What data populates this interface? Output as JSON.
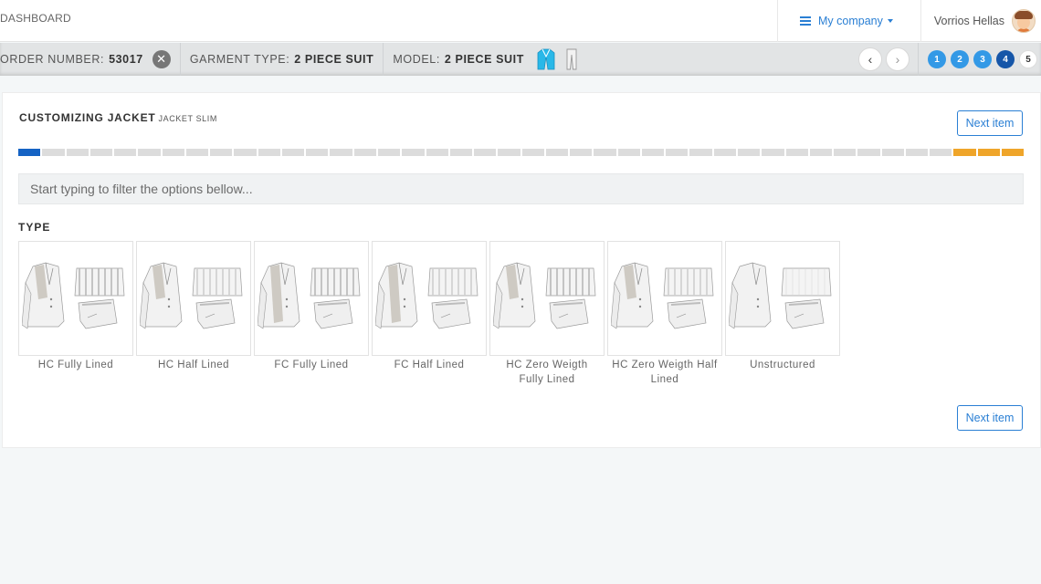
{
  "nav": {
    "brand": "DASHBOARD",
    "company": "My company",
    "user": "Vorrios Hellas"
  },
  "orderbar": {
    "order_label": "ORDER NUMBER:",
    "order_value": "53017",
    "garment_label": "GARMENT TYPE:",
    "garment_value": "2 PIECE SUIT",
    "model_label": "MODEL:",
    "model_value": "2 PIECE SUIT",
    "remove_icon": "close-circle-icon",
    "jacket_icon": "jacket-icon",
    "pants_icon": "pants-icon",
    "steps": [
      "1",
      "2",
      "3",
      "4",
      "5"
    ],
    "active_step": "4"
  },
  "panel": {
    "title": "CUSTOMIZING JACKET",
    "subtitle": "JACKET SLIM",
    "next_label": "Next item",
    "progress": {
      "total": 42,
      "current": 1,
      "warning_tail": 3
    },
    "filter_placeholder": "Start typing to filter the options bellow...",
    "section_label": "TYPE",
    "options": [
      {
        "label": "HC Fully Lined"
      },
      {
        "label": "HC Half Lined"
      },
      {
        "label": "FC Fully Lined"
      },
      {
        "label": "FC Half Lined"
      },
      {
        "label": "HC Zero Weigth Fully Lined"
      },
      {
        "label": "HC Zero Weigth Half Lined"
      },
      {
        "label": "Unstructured"
      }
    ]
  },
  "colors": {
    "accent": "#2a7fd4",
    "progress_current": "#1563c4",
    "progress_warning": "#efa52a",
    "step_done": "#3399e6",
    "step_active": "#1656a8"
  }
}
